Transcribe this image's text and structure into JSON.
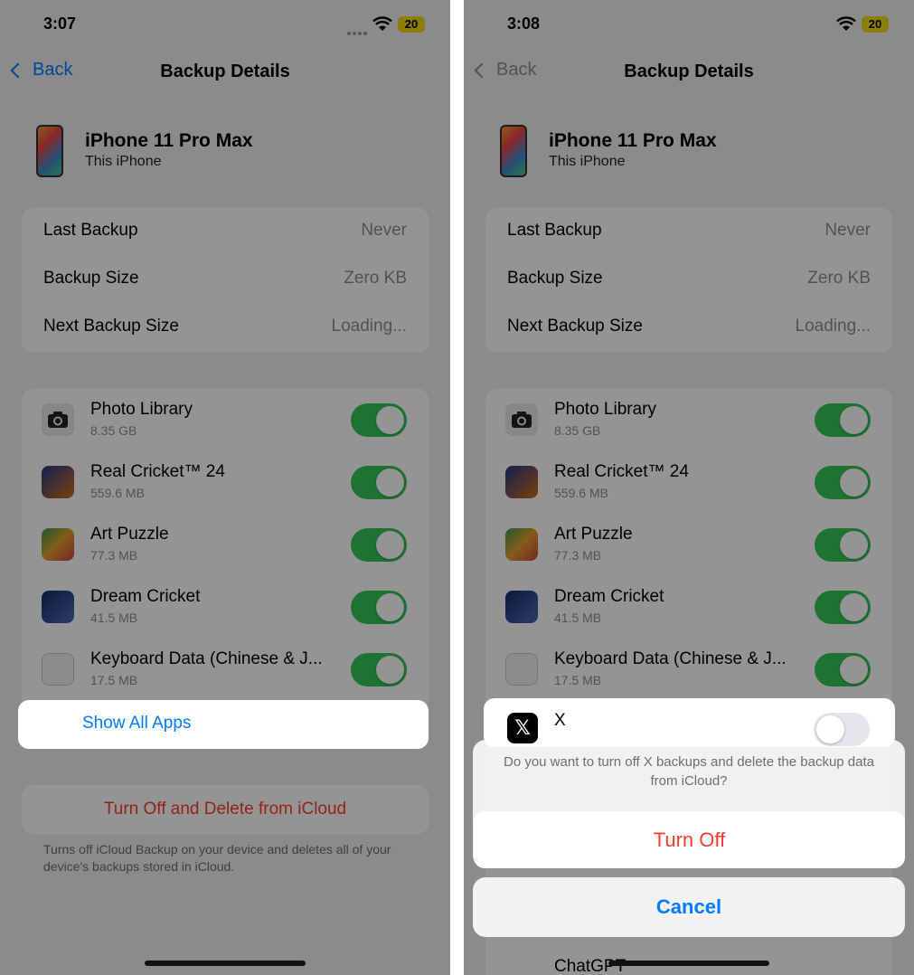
{
  "colors": {
    "accent": "#007aff",
    "danger": "#ff3b30",
    "toggle_on": "#34c759",
    "toggle_off": "#e5e5ea",
    "battery": "#f5d90a"
  },
  "left": {
    "status": {
      "time": "3:07",
      "battery": "20"
    },
    "nav": {
      "back": "Back",
      "title": "Backup Details"
    },
    "device": {
      "name": "iPhone 11 Pro Max",
      "subtitle": "This iPhone"
    },
    "info": [
      {
        "label": "Last Backup",
        "value": "Never"
      },
      {
        "label": "Backup Size",
        "value": "Zero KB"
      },
      {
        "label": "Next Backup Size",
        "value": "Loading..."
      }
    ],
    "apps": [
      {
        "name": "Photo Library",
        "size": "8.35 GB",
        "icon": "camera-icon",
        "on": true
      },
      {
        "name": "Real Cricket™ 24",
        "size": "559.6 MB",
        "icon": "real-cricket-app-icon",
        "on": true
      },
      {
        "name": "Art Puzzle",
        "size": "77.3 MB",
        "icon": "art-puzzle-app-icon",
        "on": true
      },
      {
        "name": "Dream Cricket",
        "size": "41.5 MB",
        "icon": "dream-cricket-app-icon",
        "on": true
      },
      {
        "name": "Keyboard Data (Chinese & J...",
        "size": "17.5 MB",
        "icon": "keyboard-icon",
        "on": true
      }
    ],
    "show_all": "Show All Apps",
    "delete": "Turn Off and Delete from iCloud",
    "footnote": "Turns off iCloud Backup on your device and deletes all of your device's backups stored in iCloud."
  },
  "right": {
    "status": {
      "time": "3:08",
      "battery": "20"
    },
    "nav": {
      "back": "Back",
      "title": "Backup Details"
    },
    "device": {
      "name": "iPhone 11 Pro Max",
      "subtitle": "This iPhone"
    },
    "info": [
      {
        "label": "Last Backup",
        "value": "Never"
      },
      {
        "label": "Backup Size",
        "value": "Zero KB"
      },
      {
        "label": "Next Backup Size",
        "value": "Loading..."
      }
    ],
    "apps": [
      {
        "name": "Photo Library",
        "size": "8.35 GB",
        "icon": "camera-icon",
        "on": true
      },
      {
        "name": "Real Cricket™ 24",
        "size": "559.6 MB",
        "icon": "real-cricket-app-icon",
        "on": true
      },
      {
        "name": "Art Puzzle",
        "size": "77.3 MB",
        "icon": "art-puzzle-app-icon",
        "on": true
      },
      {
        "name": "Dream Cricket",
        "size": "41.5 MB",
        "icon": "dream-cricket-app-icon",
        "on": true
      },
      {
        "name": "Keyboard Data (Chinese & J...",
        "size": "17.5 MB",
        "icon": "keyboard-icon",
        "on": true
      }
    ],
    "x_row": {
      "name": "X",
      "icon": "x-app-icon",
      "on": false
    },
    "sheet": {
      "message": "Do you want to turn off X backups and delete the backup data from iCloud?",
      "confirm": "Turn Off",
      "cancel": "Cancel"
    },
    "peek": "ChatGPT"
  }
}
